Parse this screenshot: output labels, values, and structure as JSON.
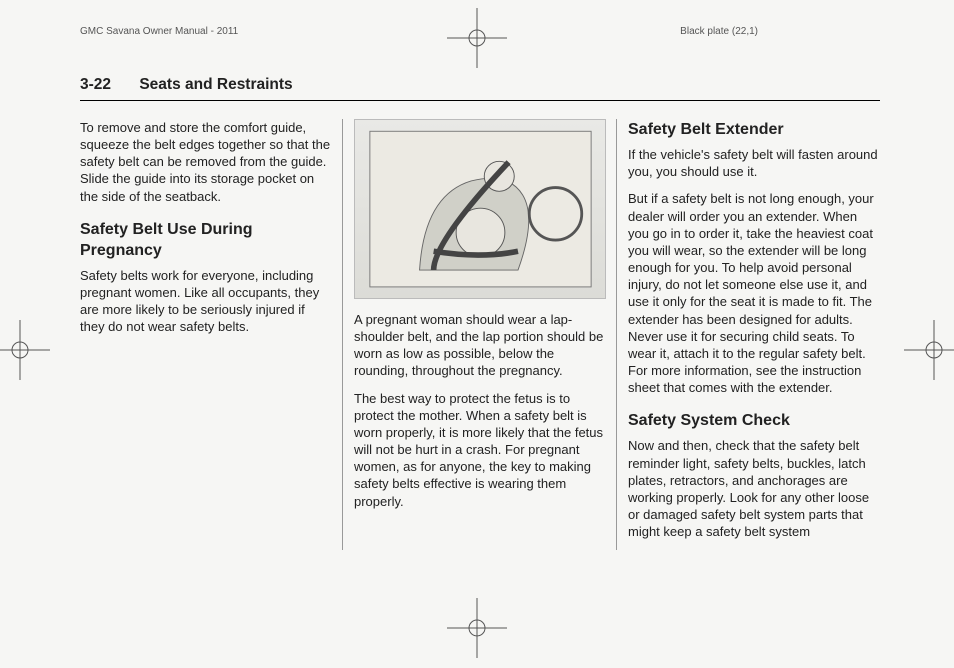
{
  "header": {
    "doc_title": "GMC Savana Owner Manual - 2011",
    "plate": "Black plate (22,1)"
  },
  "running_head": {
    "page_no": "3-22",
    "chapter": "Seats and Restraints"
  },
  "col1": {
    "p1": "To remove and store the comfort guide, squeeze the belt edges together so that the safety belt can be removed from the guide. Slide the guide into its storage pocket on the side of the seatback.",
    "h2": "Safety Belt Use During Pregnancy",
    "p2": "Safety belts work for everyone, including pregnant women. Like all occupants, they are more likely to be seriously injured if they do not wear safety belts."
  },
  "col2": {
    "fig_alt": "Illustration: pregnant driver wearing lap-shoulder belt",
    "p1": "A pregnant woman should wear a lap-shoulder belt, and the lap portion should be worn as low as possible, below the rounding, throughout the pregnancy.",
    "p2": "The best way to protect the fetus is to protect the mother. When a safety belt is worn properly, it is more likely that the fetus will not be hurt in a crash. For pregnant women, as for anyone, the key to making safety belts effective is wearing them properly."
  },
  "col3": {
    "h2a": "Safety Belt Extender",
    "p1": "If the vehicle's safety belt will fasten around you, you should use it.",
    "p2": "But if a safety belt is not long enough, your dealer will order you an extender. When you go in to order it, take the heaviest coat you will wear, so the extender will be long enough for you. To help avoid personal injury, do not let someone else use it, and use it only for the seat it is made to fit. The extender has been designed for adults. Never use it for securing child seats. To wear it, attach it to the regular safety belt. For more information, see the instruction sheet that comes with the extender.",
    "h2b": "Safety System Check",
    "p3": "Now and then, check that the safety belt reminder light, safety belts, buckles, latch plates, retractors, and anchorages are working properly. Look for any other loose or damaged safety belt system parts that might keep a safety belt system"
  }
}
